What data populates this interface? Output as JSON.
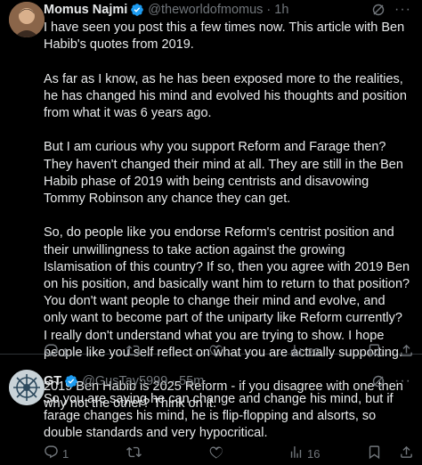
{
  "post1": {
    "author_name": "Momus Najmi",
    "handle": "@theworldofmomus",
    "separator": "·",
    "time": "1h",
    "body": "I have seen you post this a few times now. This article with Ben Habib's quotes from 2019.\n\nAs far as I know, as he has been exposed more to the realities, he has changed his mind and evolved his thoughts and position from what it was 6 years ago.\n\nBut I am curious why you support Reform and Farage then? They haven't changed their mind at all. They are still in the Ben Habib phase of 2019 with being centrists and disavowing Tommy Robinson any chance they can get.\n\nSo, do people like you endorse Reform's centrist position and their unwillingness to take action against the growing Islamisation of this country? If so, then you agree with 2019 Ben on his position, and basically want him to return to that position? You don't want people to change their mind and evolve, and only want to become part of the uniparty like Reform currently?\nI really don't understand what you are trying to show. I hope people like you self reflect on what you are actually supporting.\n\n2019 Ben Habib is 2025 Reform - if you disagree with one then why not the other? Think on it.",
    "reply_count": "1",
    "retweet_count": "",
    "like_count": "",
    "views_count": "23"
  },
  "post2": {
    "author_name": "GT",
    "handle": "@GusTay5999",
    "separator": "·",
    "time": "55m",
    "body": "So you are saying he can change and change his mind, but if farage changes his mind, he is flip-flopping and alsorts, so double standards and very hypocritical.",
    "reply_count": "1",
    "retweet_count": "",
    "like_count": "",
    "views_count": "16"
  },
  "colors": {
    "background": "#000000",
    "text": "#e7e9ea",
    "muted": "#71767b",
    "verified": "#1d9bf0",
    "divider": "#2f3336"
  },
  "icons": [
    "verified-badge-icon",
    "grok-icon",
    "more-icon",
    "reply-icon",
    "retweet-icon",
    "like-icon",
    "views-icon",
    "bookmark-icon",
    "share-icon"
  ]
}
